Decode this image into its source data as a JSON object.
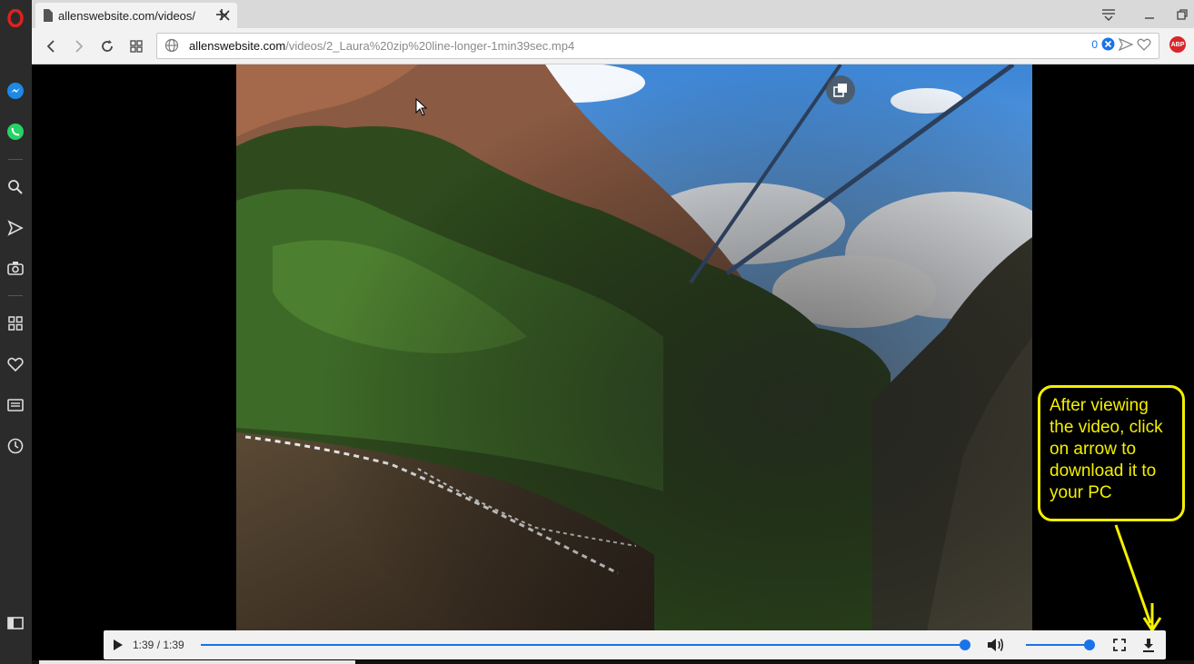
{
  "browser": {
    "tab_title": "allenswebsite.com/videos/",
    "url_domain": "allenswebsite.com",
    "url_path": "/videos/2_Laura%20zip%20line-longer-1min39sec.mp4",
    "blocked_count": "0",
    "abp_label": "ABP"
  },
  "sidebar": {
    "items": [
      "opera-logo",
      "messenger-icon",
      "whatsapp-icon",
      "search-icon",
      "send-icon",
      "camera-icon",
      "speed-dial-icon",
      "heart-icon",
      "news-icon",
      "history-icon",
      "sidebar-toggle-icon"
    ]
  },
  "player": {
    "time": "1:39 / 1:39",
    "progress": 1.0,
    "volume": 1.0
  },
  "callout": {
    "text": "After viewing the video, click on arrow to download it to your PC",
    "color": "#f4f000"
  },
  "colors": {
    "accent": "#1a73e8",
    "opera_red": "#e0201f"
  }
}
